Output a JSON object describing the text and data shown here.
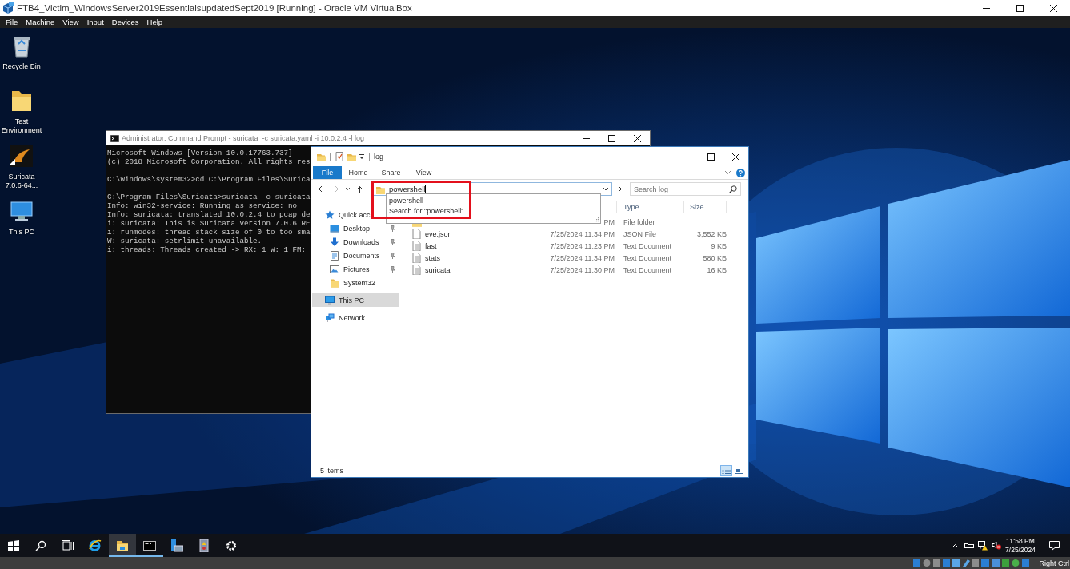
{
  "host_window": {
    "title": "FTB4_Victim_WindowsServer2019EssentialsupdatedSept2019 [Running] - Oracle VM VirtualBox",
    "menu": [
      "File",
      "Machine",
      "View",
      "Input",
      "Devices",
      "Help"
    ]
  },
  "desktop_icons": [
    {
      "label": "Recycle Bin",
      "kind": "recycle-bin"
    },
    {
      "label": "Test Environment",
      "kind": "folder"
    },
    {
      "label": "Suricata 7.0.6-64...",
      "kind": "app"
    },
    {
      "label": "This PC",
      "kind": "computer"
    }
  ],
  "cmd_window": {
    "title": "Administrator: Command Prompt - suricata  -c suricata.yaml -i 10.0.2.4 -l log",
    "blocks": [
      [
        "Microsoft Windows [Version 10.0.17763.737]",
        "(c) 2018 Microsoft Corporation. All rights res"
      ],
      [
        "C:\\Windows\\system32>cd C:\\Program Files\\Surica"
      ],
      [
        "C:\\Program Files\\Suricata>suricata -c suricata",
        "Info: win32-service: Running as service: no",
        "Info: suricata: translated 10.0.2.4 to pcap de",
        "i: suricata: This is Suricata version 7.0.6 RE",
        "i: runmodes: thread stack size of 0 to too sma",
        "W: suricata: setrlimit unavailable.",
        "i: threads: Threads created -> RX: 1 W: 1 FM:"
      ]
    ]
  },
  "explorer": {
    "title": "log",
    "ribbon_tabs": [
      {
        "label": "File",
        "selected": true
      },
      {
        "label": "Home",
        "selected": false
      },
      {
        "label": "Share",
        "selected": false
      },
      {
        "label": "View",
        "selected": false
      }
    ],
    "address": {
      "value": "powershell"
    },
    "suggestions": [
      "powershell",
      "Search for \"powershell\""
    ],
    "search": {
      "placeholder": "Search log"
    },
    "nav": [
      {
        "label": "Quick acc",
        "kind": "star",
        "selected": false,
        "children": [
          {
            "label": "Desktop",
            "kind": "desktop",
            "pinned": true,
            "selected": false
          },
          {
            "label": "Downloads",
            "kind": "downloads",
            "pinned": true,
            "selected": false
          },
          {
            "label": "Documents",
            "kind": "documents",
            "pinned": true,
            "selected": false
          },
          {
            "label": "Pictures",
            "kind": "pictures",
            "pinned": true,
            "selected": false
          },
          {
            "label": "System32",
            "kind": "folder",
            "pinned": false,
            "selected": false
          }
        ]
      },
      {
        "label": "This PC",
        "kind": "computer",
        "selected": true
      },
      {
        "label": "Network",
        "kind": "network",
        "selected": false
      }
    ],
    "columns": [
      "Type",
      "Size"
    ],
    "files": [
      {
        "kind": "folder",
        "date": "PM",
        "type": "File folder"
      },
      {
        "kind": "file",
        "name": "eve.json",
        "date": "7/25/2024 11:34 PM",
        "type": "JSON File",
        "size": "3,552 KB"
      },
      {
        "kind": "text",
        "name": "fast",
        "date": "7/25/2024 11:23 PM",
        "type": "Text Document",
        "size": "9 KB"
      },
      {
        "kind": "text",
        "name": "stats",
        "date": "7/25/2024 11:34 PM",
        "type": "Text Document",
        "size": "580 KB"
      },
      {
        "kind": "text",
        "name": "suricata",
        "date": "7/25/2024 11:30 PM",
        "type": "Text Document",
        "size": "16 KB"
      }
    ],
    "status": "5 items",
    "view_buttons": [
      {
        "kind": "details",
        "selected": true
      },
      {
        "kind": "large-icons",
        "selected": false
      }
    ]
  },
  "taskbar": {
    "buttons": [
      {
        "kind": "start"
      },
      {
        "kind": "search"
      },
      {
        "kind": "task-view"
      }
    ],
    "apps": [
      {
        "kind": "browser",
        "open": false,
        "selected": false
      },
      {
        "kind": "file-explorer",
        "open": true,
        "selected": true
      },
      {
        "kind": "terminal",
        "open": true,
        "selected": false
      },
      {
        "kind": "server-manager",
        "open": false,
        "selected": false
      },
      {
        "kind": "app",
        "open": false,
        "selected": false
      },
      {
        "kind": "settings",
        "open": false,
        "selected": false
      }
    ],
    "tray": {
      "time": "11:58 PM",
      "date": "7/25/2024"
    }
  },
  "status_bar": {
    "host_key": "Right Ctrl"
  }
}
